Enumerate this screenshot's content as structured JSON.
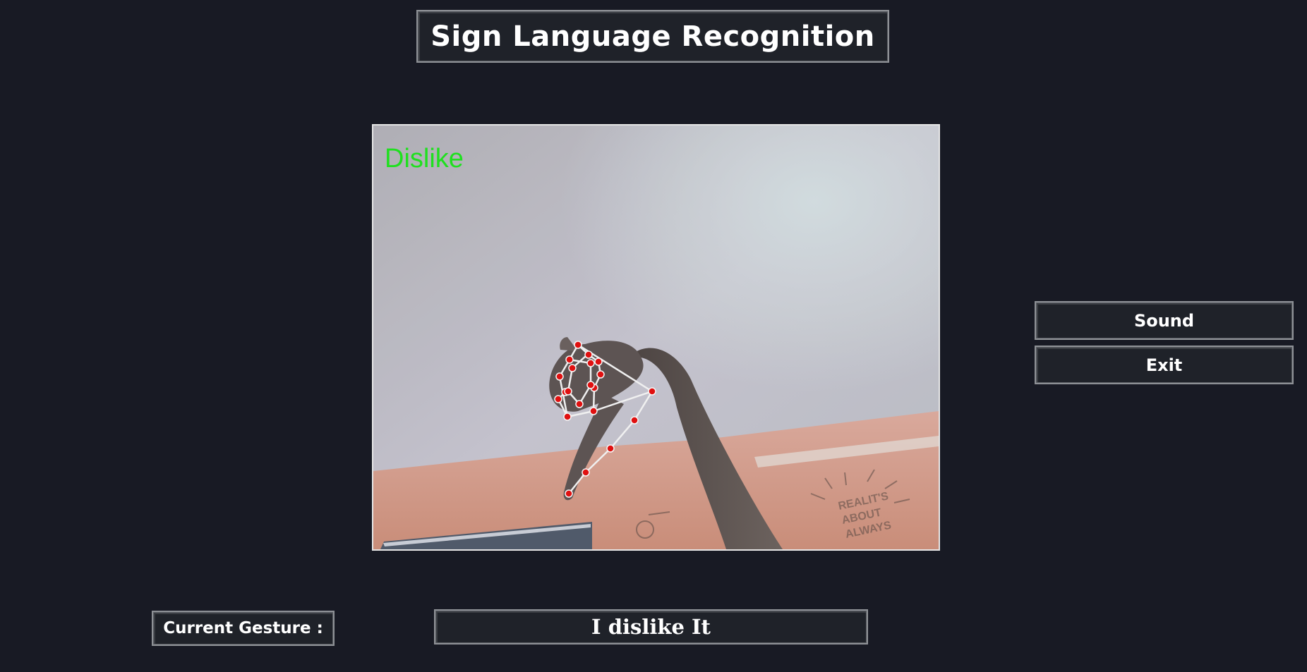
{
  "app": {
    "title": "Sign Language Recognition"
  },
  "video": {
    "overlay_label": "Dislike",
    "overlay_color": "#1fe01f",
    "landmark_color": "#e01010",
    "connection_color": "#f0f0f0"
  },
  "controls": {
    "sound_label": "Sound",
    "exit_label": "Exit"
  },
  "gesture": {
    "label": "Current Gesture :",
    "value": "I dislike It"
  },
  "colors": {
    "background": "#181a24",
    "panel": "#1f2229",
    "border": "#8e9196",
    "text": "#ffffff"
  }
}
